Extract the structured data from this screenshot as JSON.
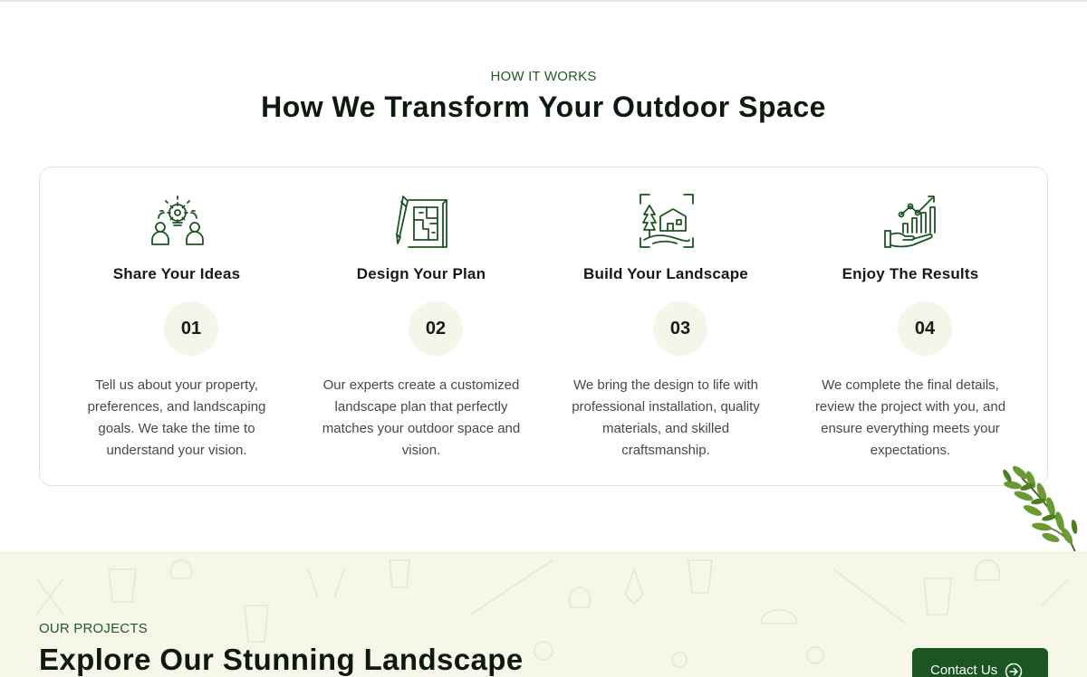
{
  "how_it_works": {
    "eyebrow": "HOW IT WORKS",
    "title": "How We Transform Your Outdoor Space",
    "steps": [
      {
        "icon": "idea-bulb-people-icon",
        "title": "Share Your Ideas",
        "number": "01",
        "description": "Tell us about your property, preferences, and landscaping goals. We take the time to understand your vision."
      },
      {
        "icon": "blueprint-pencil-icon",
        "title": "Design Your Plan",
        "number": "02",
        "description": "Our experts create a customized landscape plan that perfectly matches your outdoor space and vision."
      },
      {
        "icon": "house-tree-frame-icon",
        "title": "Build Your Landscape",
        "number": "03",
        "description": "We bring the design to life with professional installation, quality materials, and skilled craftsmanship."
      },
      {
        "icon": "growth-chart-hand-icon",
        "title": "Enjoy The Results",
        "number": "04",
        "description": "We complete the final details, review the project with you, and ensure everything meets your expectations."
      }
    ]
  },
  "projects": {
    "eyebrow": "OUR PROJECTS",
    "title": "Explore Our Stunning Landscape",
    "contact_label": "Contact Us"
  },
  "colors": {
    "brand_green": "#1c5422",
    "accent_text_green": "#1f5a23",
    "number_badge_bg": "#f4f6e9",
    "projects_bg": "#f6f7e8"
  }
}
